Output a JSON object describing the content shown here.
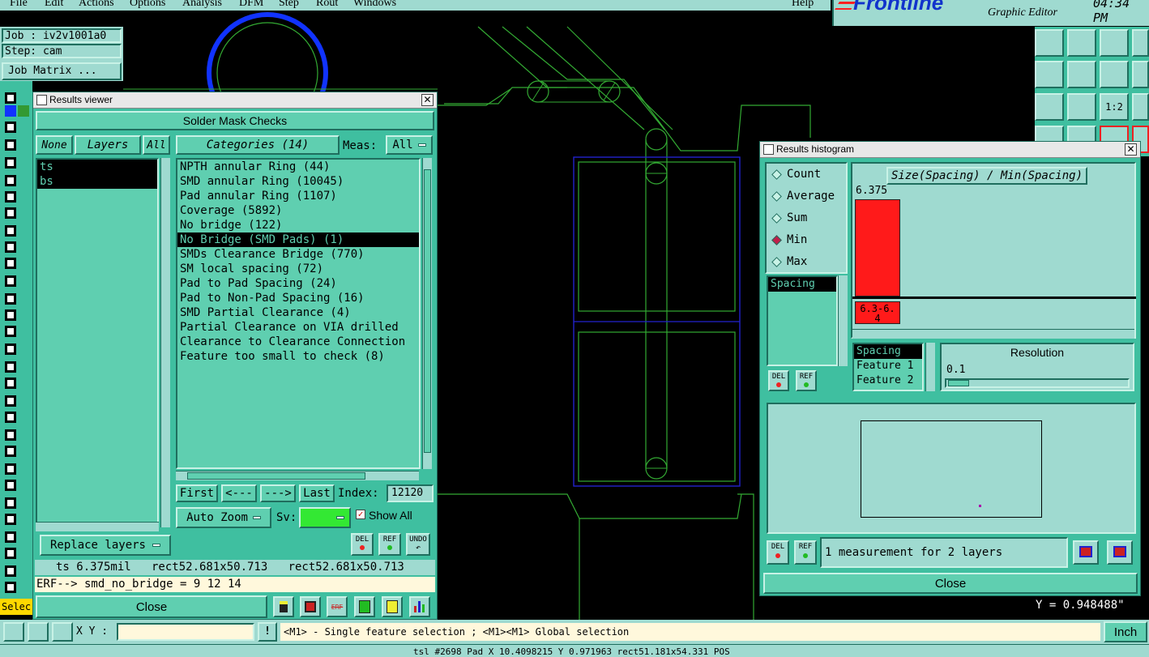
{
  "menu": {
    "items": [
      "File",
      "Edit",
      "Actions",
      "Options",
      "Analysis",
      "DFM",
      "Step",
      "Rout",
      "Windows"
    ],
    "help": "Help"
  },
  "brand": {
    "logo": "Frontline",
    "subtitle": "Graphic Editor",
    "time": "04:34 PM"
  },
  "job": {
    "job_line": "Job : iv2v1001a0",
    "step_line": "Step: cam",
    "matrix_button": "Job Matrix ..."
  },
  "results_viewer": {
    "title": "Results viewer",
    "header": "Solder Mask Checks",
    "none_button": "None",
    "layers_button": "Layers",
    "all_button": "All",
    "categories_button": "Categories (14)",
    "meas_label": "Meas:",
    "meas_value": "All",
    "layers": [
      "ts",
      "bs"
    ],
    "categories": [
      "NPTH annular Ring (44)",
      "SMD annular Ring (10045)",
      "Pad annular Ring (1107)",
      "Coverage (5892)",
      "No bridge (122)",
      "No Bridge (SMD Pads) (1)",
      "SMDs Clearance Bridge (770)",
      "SM local spacing (72)",
      "Pad to Pad Spacing (24)",
      "Pad to Non-Pad Spacing (16)",
      "SMD Partial Clearance (4)",
      "Partial Clearance on VIA drilled",
      "Clearance to Clearance Connection",
      "Feature too small to check (8)"
    ],
    "selected_category": 5,
    "nav": {
      "first": "First",
      "prev": "<---",
      "next": "--->",
      "last": "Last",
      "index_label": "Index:",
      "index_value": "12120"
    },
    "auto_zoom": "Auto Zoom",
    "sv_label": "Sv:",
    "show_all": "Show All",
    "replace_layers": "Replace layers",
    "del_label": "DEL",
    "ref_label": "REF",
    "undo_label": "UNDO",
    "info_line": "ts 6.375mil   rect52.681x50.713   rect52.681x50.713",
    "erf_line": "ERF--> smd_no_bridge = 9 12 14",
    "close": "Close"
  },
  "histogram": {
    "title": "Results histogram",
    "options": [
      "Count",
      "Average",
      "Sum",
      "Min",
      "Max"
    ],
    "selected_option": "Min",
    "chart_title": "Size(Spacing) / Min(Spacing)",
    "bar_value": "6.375",
    "bar_label": "6.3-6.4",
    "bar_fraction": 1.0,
    "measure_list": [
      "Spacing"
    ],
    "axis_list": [
      "Spacing",
      "Feature 1",
      "Feature 2"
    ],
    "resolution_label": "Resolution",
    "resolution_value": "0.1",
    "del_label": "DEL",
    "ref_label": "REF",
    "status": "1 measurement for 2 layers",
    "close": "Close"
  },
  "coords": {
    "y_readout": "Y = 0.948488\"",
    "units": "Inch"
  },
  "status_bar": {
    "select_label": "Selec",
    "xy_label": "X Y :",
    "hint": "<M1> - Single feature selection ; <M1><M1> Global selection",
    "bottom_line": "tsl #2698 Pad X 10.4098215 Y 0.971963 rect51.181x54.331 POS"
  },
  "colors": {
    "panel": "#3fbfa0",
    "panel_light": "#9fdad0",
    "accent": "#5fcfb0",
    "bar": "#ff1a1a",
    "sv_green": "#33e833",
    "canvas": "#000000"
  }
}
